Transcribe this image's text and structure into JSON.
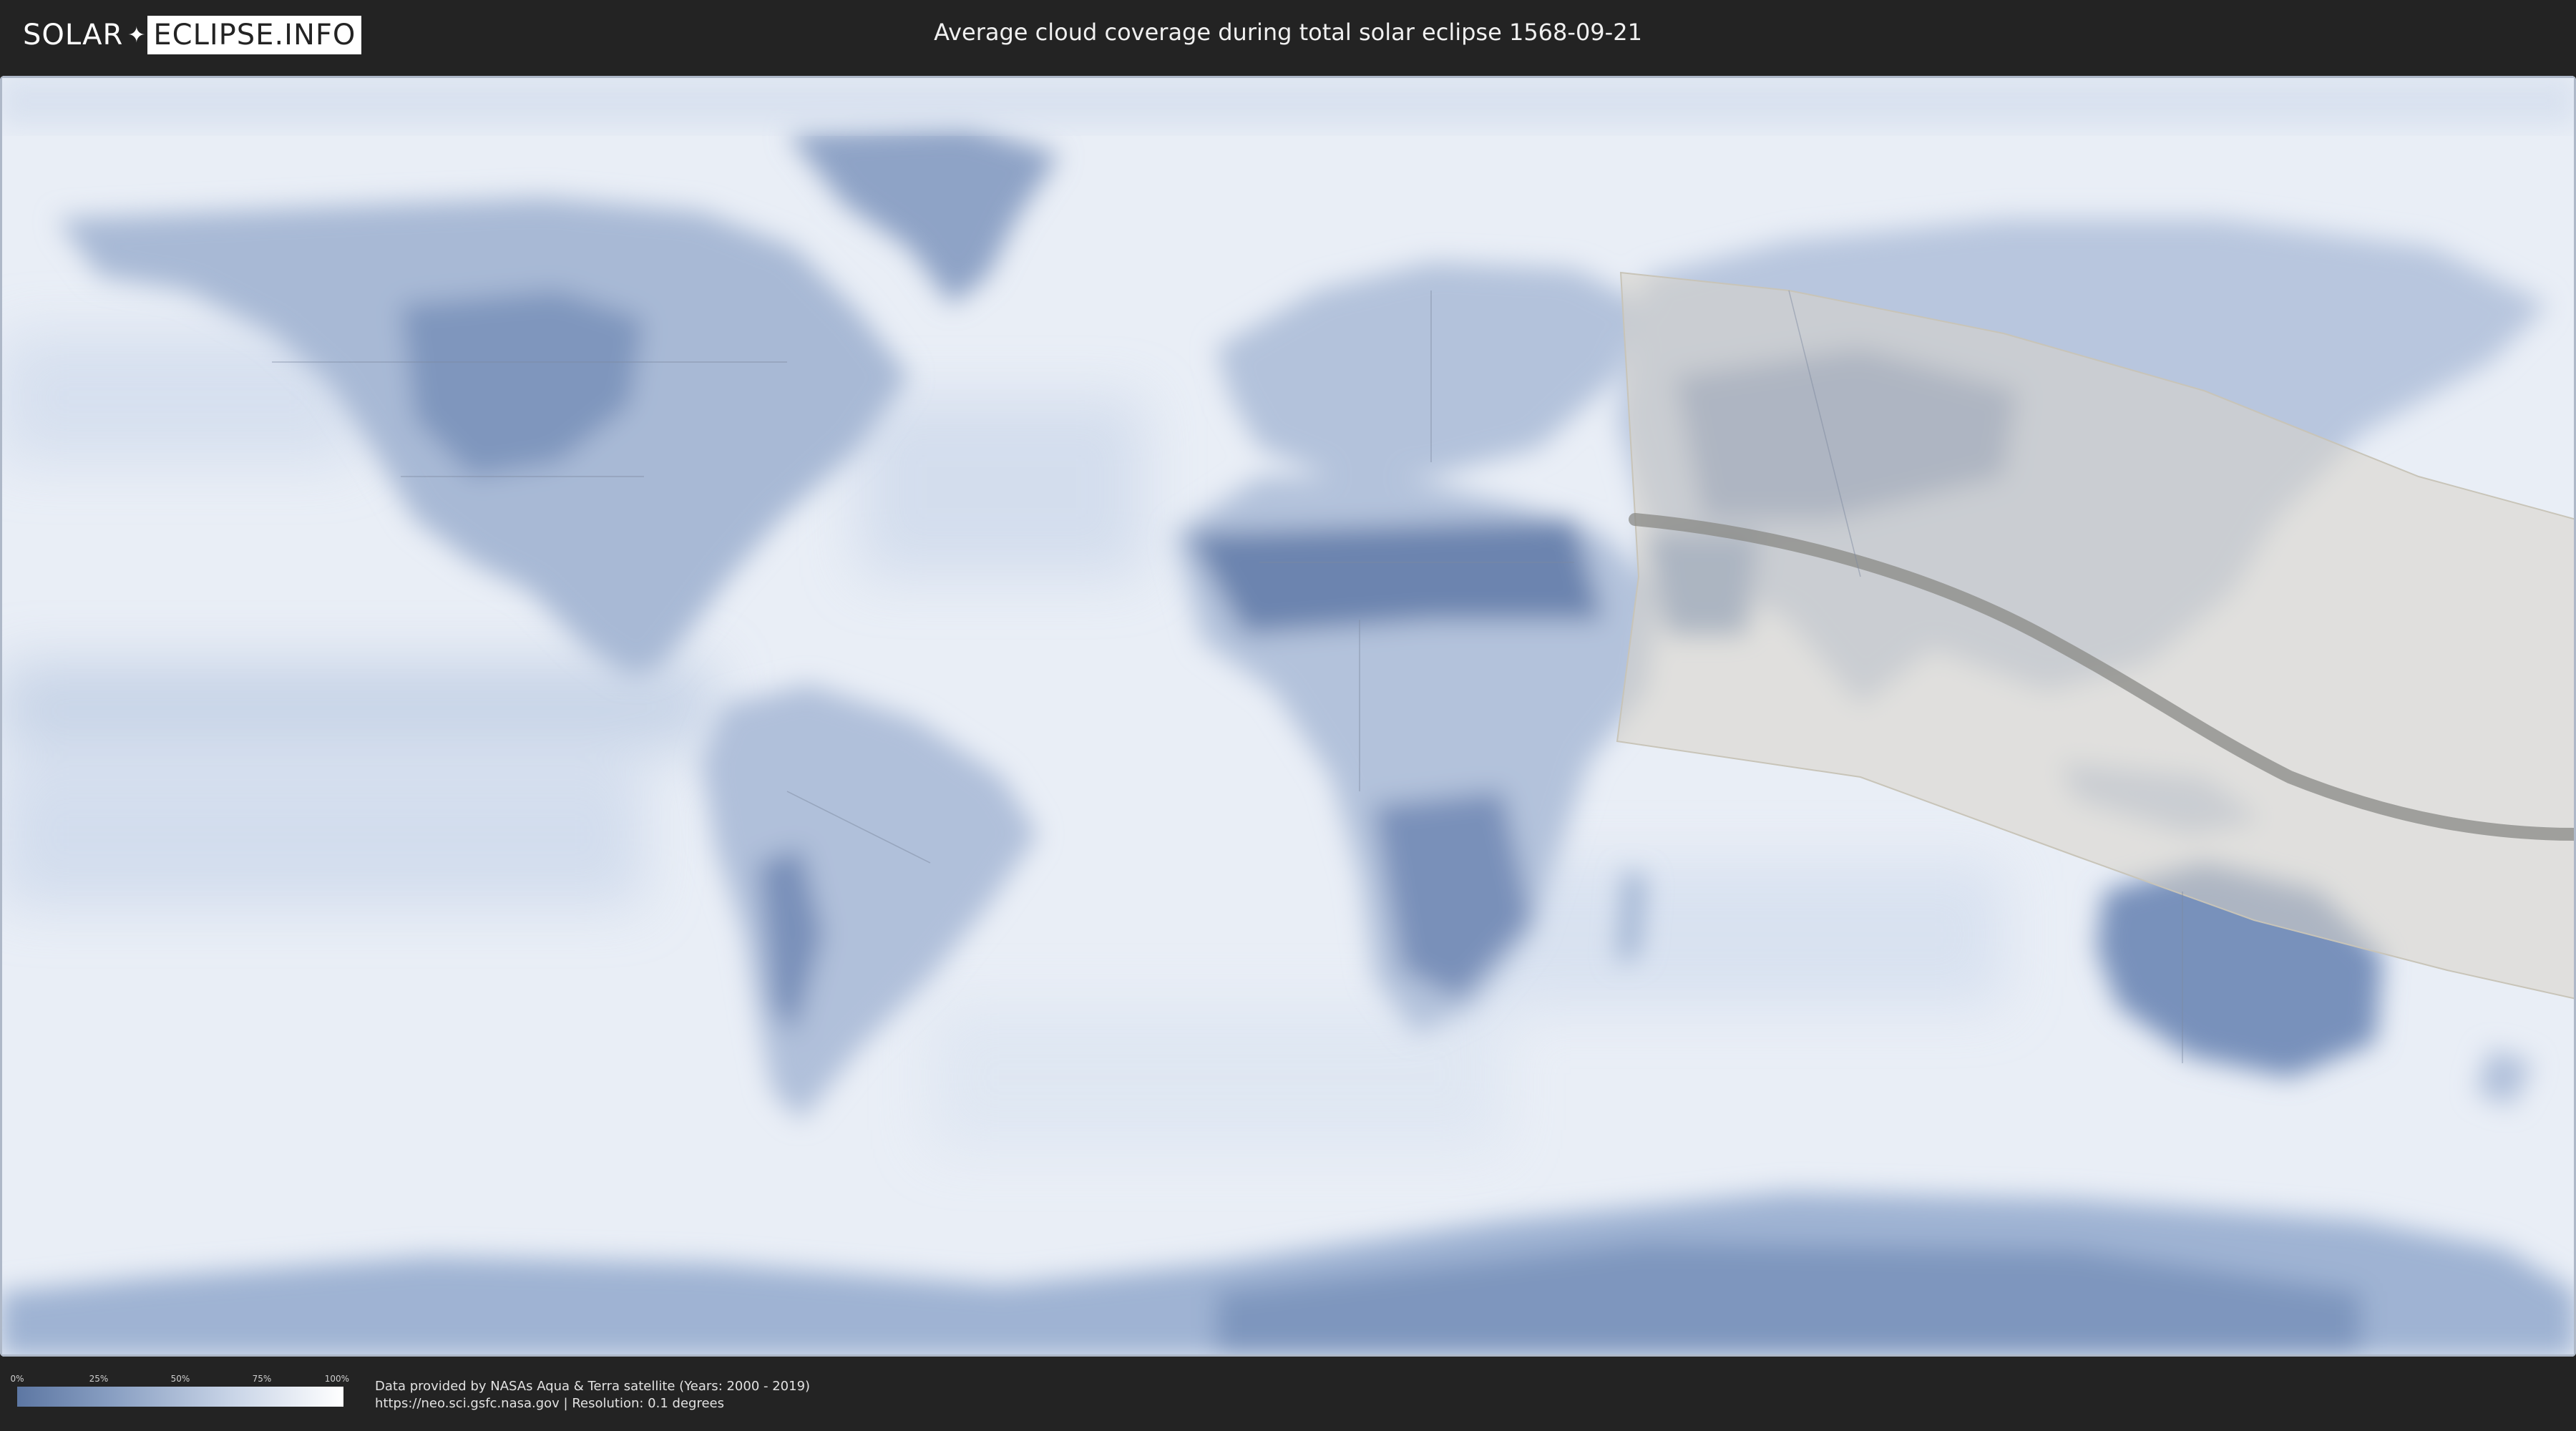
{
  "header": {
    "logo_left": "SOLAR",
    "logo_sep": "✦",
    "logo_right": "ECLIPSE.INFO",
    "title": "Average cloud coverage during total solar eclipse 1568-09-21"
  },
  "map": {
    "colors": {
      "ocean": "#e9eef6",
      "land_dark": "#6f86b0",
      "land_mid": "#9fb2d1",
      "ice": "#b7c6de",
      "band": "#c5d2e6",
      "eclipse_region": "#d8d4c8",
      "eclipse_path": "#8a8a86",
      "border": "#7d8aa0"
    }
  },
  "legend": {
    "ticks": [
      "0%",
      "25%",
      "50%",
      "75%",
      "100%"
    ],
    "tick_values": [
      0,
      25,
      50,
      75,
      100
    ]
  },
  "credits": {
    "line1": "Data provided by NASAs Aqua & Terra satellite (Years: 2000 - 2019)",
    "line2": "https://neo.sci.gsfc.nasa.gov | Resolution: 0.1 degrees"
  }
}
